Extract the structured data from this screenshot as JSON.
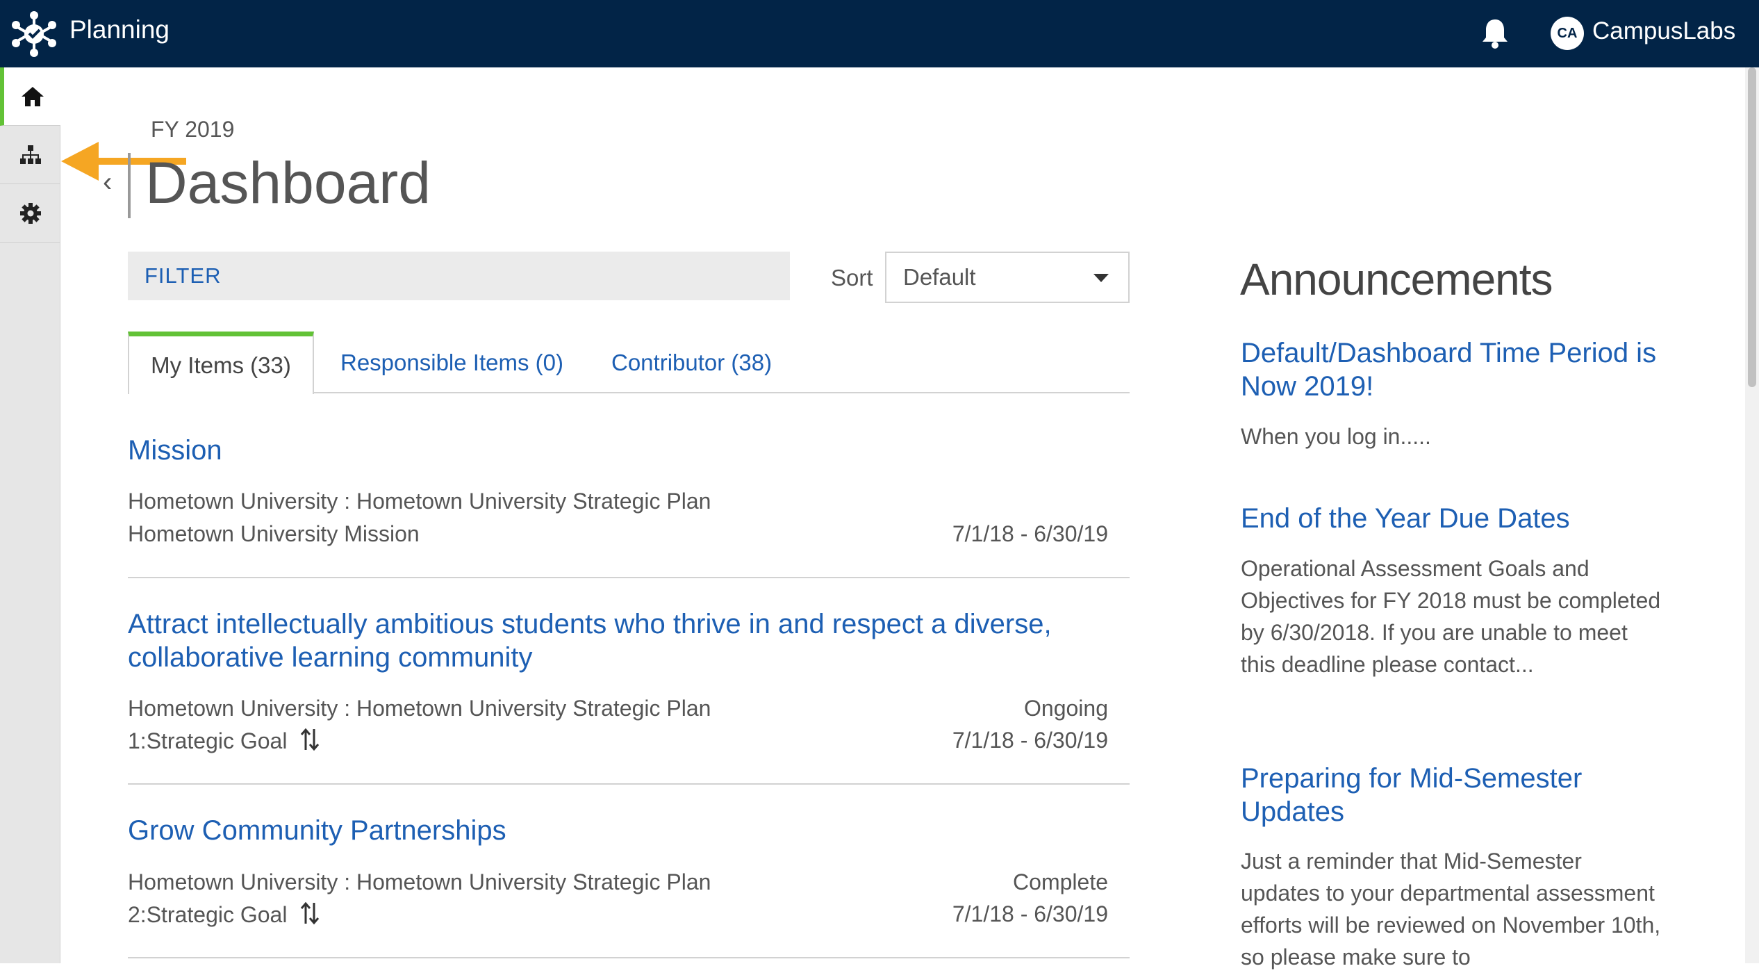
{
  "header": {
    "app_title": "Planning",
    "user_initials": "CA",
    "user_name": "CampusLabs",
    "logo_icon": "campuslabs-logo-icon",
    "notification_icon": "bell-icon"
  },
  "sidebar": {
    "items": [
      {
        "icon": "home-icon",
        "active": true
      },
      {
        "icon": "org-chart-icon",
        "active": false
      },
      {
        "icon": "gear-icon",
        "active": false
      }
    ]
  },
  "page": {
    "period": "FY 2019",
    "title": "Dashboard",
    "back_icon": "chevron-left-icon"
  },
  "filter": {
    "label": "FILTER"
  },
  "sort": {
    "label": "Sort",
    "selected": "Default"
  },
  "tabs": [
    {
      "label": "My Items (33)",
      "active": true
    },
    {
      "label": "Responsible Items (0)",
      "active": false
    },
    {
      "label": "Contributor (38)",
      "active": false
    }
  ],
  "items": [
    {
      "title": "Mission",
      "line1": "Hometown University : Hometown University Strategic Plan",
      "line2": "Hometown University Mission",
      "status": "",
      "dates": "7/1/18 - 6/30/19"
    },
    {
      "title": "Attract intellectually ambitious students who thrive in and respect a diverse, collaborative learning community",
      "line1": "Hometown University : Hometown University Strategic Plan",
      "line2": "1:Strategic Goal",
      "status": "Ongoing",
      "dates": "7/1/18 - 6/30/19"
    },
    {
      "title": "Grow Community Partnerships",
      "line1": "Hometown University : Hometown University Strategic Plan",
      "line2": "2:Strategic Goal",
      "status": "Complete",
      "dates": "7/1/18 - 6/30/19"
    }
  ],
  "announcements": {
    "heading": "Announcements",
    "entries": [
      {
        "title": "Default/Dashboard Time Period is Now 2019!",
        "body": "When you log in....."
      },
      {
        "title": "End of the Year Due Dates",
        "body": "Operational Assessment Goals and Objectives for FY 2018 must be completed by 6/30/2018. If you are unable to meet this deadline please contact..."
      },
      {
        "title": "Preparing for Mid-Semester Updates",
        "body": "Just a reminder that Mid-Semester updates to your departmental assessment efforts will be reviewed on November 10th, so please make sure to"
      }
    ]
  },
  "colors": {
    "topbar": "#022447",
    "accent_green": "#62c236",
    "link_blue": "#1d5fb3",
    "annotation_arrow": "#f5a623"
  }
}
